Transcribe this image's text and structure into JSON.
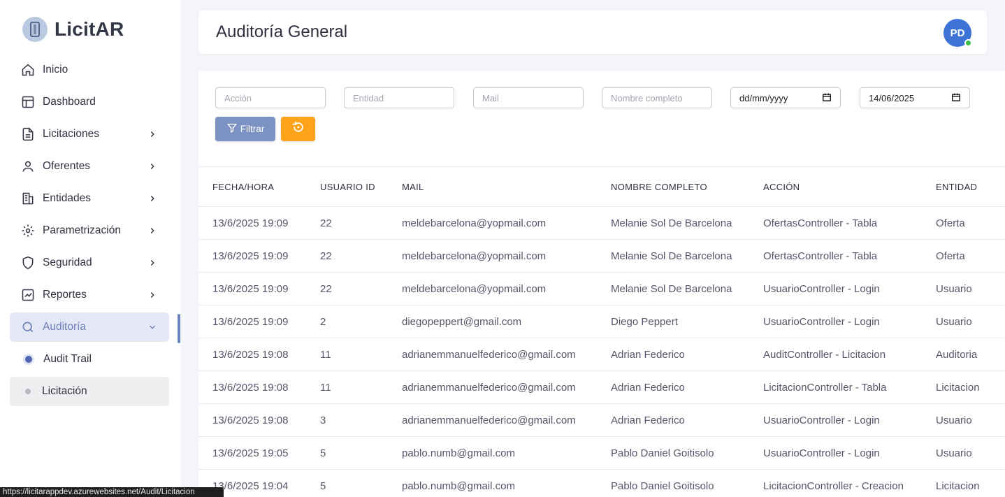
{
  "app": {
    "name": "LicitAR"
  },
  "sidebar": {
    "items": [
      {
        "label": "Inicio",
        "icon": "home-icon"
      },
      {
        "label": "Dashboard",
        "icon": "layout-icon"
      },
      {
        "label": "Licitaciones",
        "icon": "file-text-icon"
      },
      {
        "label": "Oferentes",
        "icon": "user-icon"
      },
      {
        "label": "Entidades",
        "icon": "building-icon"
      },
      {
        "label": "Parametrización",
        "icon": "gear-icon"
      },
      {
        "label": "Seguridad",
        "icon": "shield-icon"
      },
      {
        "label": "Reportes",
        "icon": "chart-icon"
      },
      {
        "label": "Auditoría",
        "icon": "search-icon"
      }
    ],
    "subitems": [
      {
        "label": "Audit Trail"
      },
      {
        "label": "Licitación"
      }
    ]
  },
  "header": {
    "title": "Auditoría General",
    "avatar_initials": "PD"
  },
  "filters": {
    "accion_placeholder": "Acción",
    "entidad_placeholder": "Entidad",
    "mail_placeholder": "Mail",
    "nombre_placeholder": "Nombre completo",
    "date_from": "dd/mm/yyyy",
    "date_to": "14/06/2025",
    "filter_button": "Filtrar"
  },
  "table": {
    "headers": [
      "FECHA/HORA",
      "USUARIO ID",
      "MAIL",
      "NOMBRE COMPLETO",
      "ACCIÓN",
      "ENTIDAD"
    ],
    "rows": [
      [
        "13/6/2025 19:09",
        "22",
        "meldebarcelona@yopmail.com",
        "Melanie Sol De Barcelona",
        "OfertasController - Tabla",
        "Oferta"
      ],
      [
        "13/6/2025 19:09",
        "22",
        "meldebarcelona@yopmail.com",
        "Melanie Sol De Barcelona",
        "OfertasController - Tabla",
        "Oferta"
      ],
      [
        "13/6/2025 19:09",
        "22",
        "meldebarcelona@yopmail.com",
        "Melanie Sol De Barcelona",
        "UsuarioController - Login",
        "Usuario"
      ],
      [
        "13/6/2025 19:09",
        "2",
        "diegopeppert@gmail.com",
        "Diego Peppert",
        "UsuarioController - Login",
        "Usuario"
      ],
      [
        "13/6/2025 19:08",
        "11",
        "adrianemmanuelfederico@gmail.com",
        "Adrian Federico",
        "AuditController - Licitacion",
        "Auditoria"
      ],
      [
        "13/6/2025 19:08",
        "11",
        "adrianemmanuelfederico@gmail.com",
        "Adrian Federico",
        "LicitacionController - Tabla",
        "Licitacion"
      ],
      [
        "13/6/2025 19:08",
        "3",
        "adrianemmanuelfederico@gmail.com",
        "Adrian Federico",
        "UsuarioController - Login",
        "Usuario"
      ],
      [
        "13/6/2025 19:05",
        "5",
        "pablo.numb@gmail.com",
        "Pablo Daniel Goitisolo",
        "UsuarioController - Login",
        "Usuario"
      ],
      [
        "13/6/2025 19:04",
        "5",
        "pablo.numb@gmail.com",
        "Pablo Daniel Goitisolo",
        "LicitacionController - Creacion",
        "Licitacion"
      ]
    ]
  },
  "statusbar": {
    "url": "https://licitarappdev.azurewebsites.net/Audit/Licitacion"
  },
  "colors": {
    "accent": "#7b92c3",
    "reset": "#ffa31a",
    "avatar": "#3d72d6",
    "online": "#39c04b"
  }
}
